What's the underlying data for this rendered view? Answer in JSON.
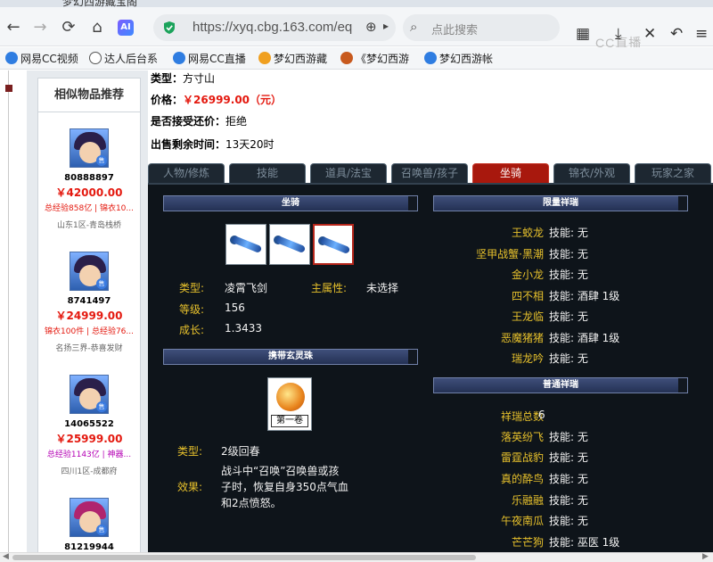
{
  "browser": {
    "tab_title": "梦幻西游藏宝阁",
    "url": "https://xyq.cbg.163.com/eq",
    "search_placeholder": "点此搜索",
    "ai_label": "AI",
    "watermark": "CC直播",
    "bookmarks": [
      {
        "label": "网易CC视频",
        "color": "#2f7de1"
      },
      {
        "label": "达人后台系",
        "color": "#555555"
      },
      {
        "label": "网易CC直播",
        "color": "#2f7de1"
      },
      {
        "label": "梦幻西游藏",
        "color": "#f0a020"
      },
      {
        "label": "《梦幻西游",
        "color": "#c85a1e"
      },
      {
        "label": "梦幻西游帐",
        "color": "#2f7de1"
      }
    ]
  },
  "recommend": {
    "title": "相似物品推荐",
    "items": [
      {
        "id": "80888897",
        "price": "￥42000.00",
        "tags": "总经验858亿 | 锦衣10...",
        "tag_color": "#e4190f",
        "server": "山东1区-青岛栈桥"
      },
      {
        "id": "8741497",
        "price": "￥24999.00",
        "tags": "锦衣100件 | 总经验76...",
        "tag_color": "#e4190f",
        "server": "名扬三界-恭喜发财"
      },
      {
        "id": "14065522",
        "price": "￥25999.00",
        "tags": "总经验1143亿 | 神器...",
        "tag_color": "#b400b4",
        "server": "四川1区-成都府"
      },
      {
        "id": "81219944",
        "price": "",
        "tags": "",
        "tag_color": "#e4190f",
        "server": ""
      }
    ]
  },
  "item_info": {
    "type_label": "类型：",
    "type_value": "方寸山",
    "price_label": "价格：",
    "price_value": "￥26999.00（元）",
    "bargain_label": "是否接受还价：",
    "bargain_value": "拒绝",
    "time_label": "出售剩余时间：",
    "time_value": "13天20时"
  },
  "tabs": [
    "人物/修炼",
    "技能",
    "道具/法宝",
    "召唤兽/孩子",
    "坐骑",
    "锦衣/外观",
    "玩家之家"
  ],
  "active_tab": 4,
  "mount_section": {
    "title": "坐骑",
    "type_label": "类型:",
    "type_value": "凌霄飞剑",
    "attr_label": "主属性:",
    "attr_value": "未选择",
    "level_label": "等级:",
    "level_value": "156",
    "growth_label": "成长:",
    "growth_value": "1.3433"
  },
  "orb_section": {
    "title": "携带玄灵珠",
    "caption": "第一卷",
    "type_label": "类型:",
    "type_value": "2级回春",
    "effect_label": "效果:",
    "effect_lines": [
      "战斗中“召唤”召唤兽或孩",
      "子时，恢复自身350点气血",
      "和2点愤怒。"
    ]
  },
  "limited_section": {
    "title": "限量祥瑞",
    "rows": [
      {
        "name": "王蛟龙",
        "skill": "技能:  无"
      },
      {
        "name": "坚甲战蟹·黑潮",
        "skill": "技能:  无"
      },
      {
        "name": "金小龙",
        "skill": "技能:  无"
      },
      {
        "name": "四不相",
        "skill": "技能:  酒肆    1级"
      },
      {
        "name": "王龙临",
        "skill": "技能:  无"
      },
      {
        "name": "恶魔猪猪",
        "skill": "技能:  酒肆    1级"
      },
      {
        "name": "瑞龙吟",
        "skill": "技能:  无"
      }
    ]
  },
  "normal_section": {
    "title": "普通祥瑞",
    "total_label": "祥瑞总数",
    "total_value": "6",
    "rows": [
      {
        "name": "落英纷飞",
        "skill": "技能:  无"
      },
      {
        "name": "雷霆战豹",
        "skill": "技能:  无"
      },
      {
        "name": "真的酔鸟",
        "skill": "技能:  无"
      },
      {
        "name": "乐融融",
        "skill": "技能:  无"
      },
      {
        "name": "午夜南瓜",
        "skill": "技能:  无"
      },
      {
        "name": "芒芒狗",
        "skill": "技能:  巫医    1级"
      }
    ]
  }
}
